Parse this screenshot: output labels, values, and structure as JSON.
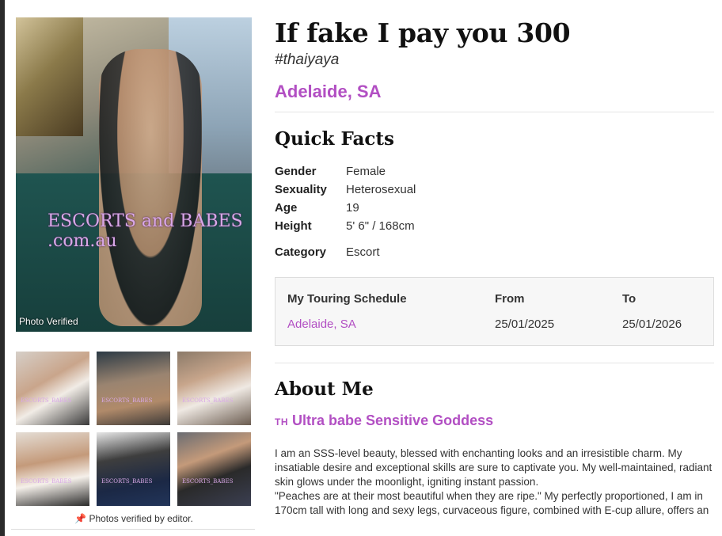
{
  "gallery": {
    "watermark": "ESCORTS and BABES .com.au",
    "verified_label": "Photo Verified",
    "thumb_watermark": "ESCORTS_BABES",
    "editor_note": "Photos verified by editor."
  },
  "profile": {
    "title": "If fake I pay you 300",
    "handle": "#thaiyaya",
    "location": "Adelaide, SA"
  },
  "quick_facts": {
    "heading": "Quick Facts",
    "rows": [
      {
        "label": "Gender",
        "value": "Female"
      },
      {
        "label": "Sexuality",
        "value": "Heterosexual"
      },
      {
        "label": "Age",
        "value": "19"
      },
      {
        "label": "Height",
        "value": "5' 6\" / 168cm"
      },
      {
        "label": "Category",
        "value": "Escort"
      }
    ]
  },
  "schedule": {
    "col1": "My Touring Schedule",
    "col2": "From",
    "col3": "To",
    "location": "Adelaide, SA",
    "from": "25/01/2025",
    "to": "25/01/2026"
  },
  "about": {
    "heading": "About Me",
    "flag": "TH",
    "tagline": "Ultra babe Sensitive Goddess",
    "para1": "I am an SSS-level beauty, blessed with enchanting looks and an irresistible charm. My insatiable desire and exceptional skills are sure to captivate you. My well-maintained, radiant skin glows under the moonlight, igniting instant passion.",
    "para2": "\"Peaches are at their most beautiful when they are ripe.\" My perfectly proportioned, I am in 170cm tall with long and sexy legs, curvaceous figure, combined with E-cup allure, offers an"
  },
  "colors": {
    "accent": "#b24fc3"
  }
}
